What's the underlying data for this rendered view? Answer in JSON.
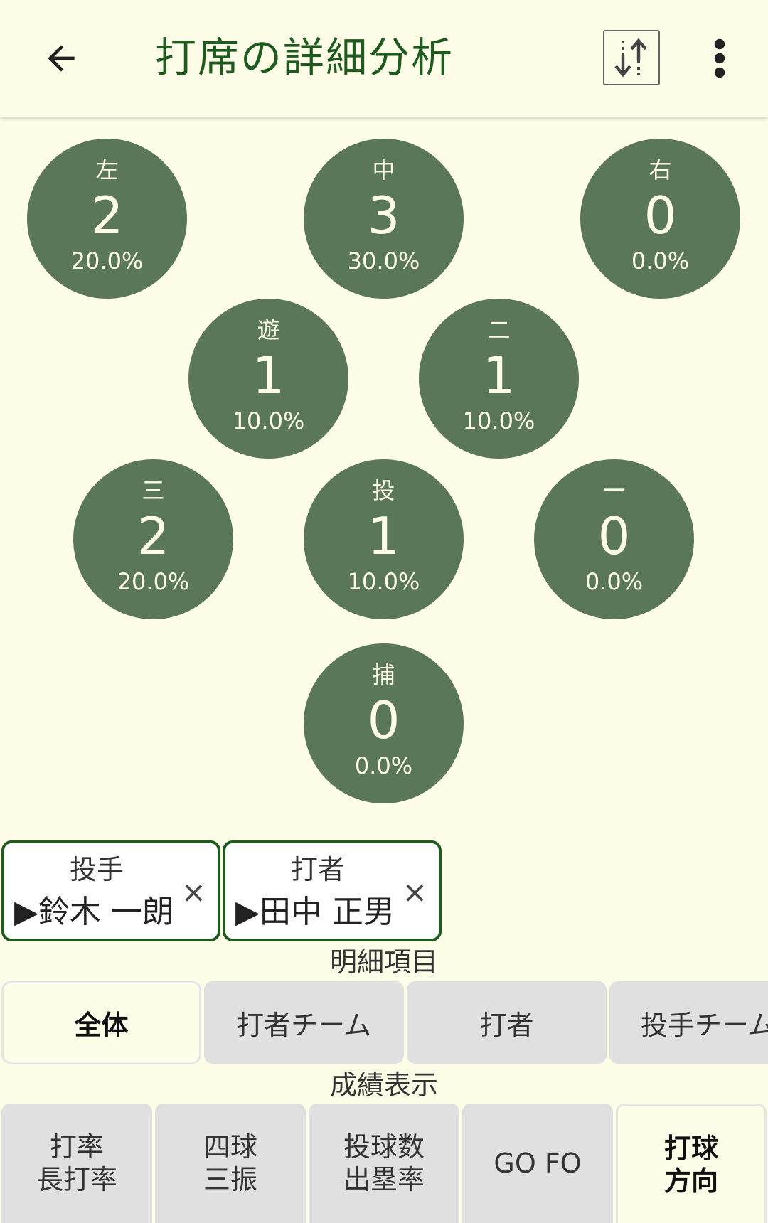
{
  "header": {
    "title": "打席の詳細分析",
    "back_icon": "arrow-left-icon",
    "swap_icon": "swap-vertical-icon",
    "more_icon": "more-vert-icon"
  },
  "field": [
    {
      "pos": "左",
      "count": "2",
      "pct": "20.0%"
    },
    {
      "pos": "中",
      "count": "3",
      "pct": "30.0%"
    },
    {
      "pos": "右",
      "count": "0",
      "pct": "0.0%"
    },
    {
      "pos": "遊",
      "count": "1",
      "pct": "10.0%"
    },
    {
      "pos": "二",
      "count": "1",
      "pct": "10.0%"
    },
    {
      "pos": "三",
      "count": "2",
      "pct": "20.0%"
    },
    {
      "pos": "投",
      "count": "1",
      "pct": "10.0%"
    },
    {
      "pos": "一",
      "count": "0",
      "pct": "0.0%"
    },
    {
      "pos": "捕",
      "count": "0",
      "pct": "0.0%"
    }
  ],
  "filters": [
    {
      "label": "投手",
      "value": "▶鈴木 一朗",
      "close": "×"
    },
    {
      "label": "打者",
      "value": "▶田中 正男",
      "close": "×"
    }
  ],
  "detail_section": {
    "label": "明細項目",
    "tabs": [
      "全体",
      "打者チーム",
      "打者",
      "投手チーム"
    ],
    "active": "全体"
  },
  "stats_section": {
    "label": "成績表示",
    "buttons": [
      {
        "line1": "打率",
        "line2": "長打率"
      },
      {
        "line1": "四球",
        "line2": "三振"
      },
      {
        "line1": "投球数",
        "line2": "出塁率"
      },
      {
        "line1": "GO FO",
        "line2": ""
      },
      {
        "line1": "打球",
        "line2": "方向"
      }
    ],
    "active": "打球方向"
  },
  "colors": {
    "background": "#fdfde8",
    "circle": "#5a7859",
    "accent": "#1f5a1f",
    "button": "#e0e0e0"
  }
}
